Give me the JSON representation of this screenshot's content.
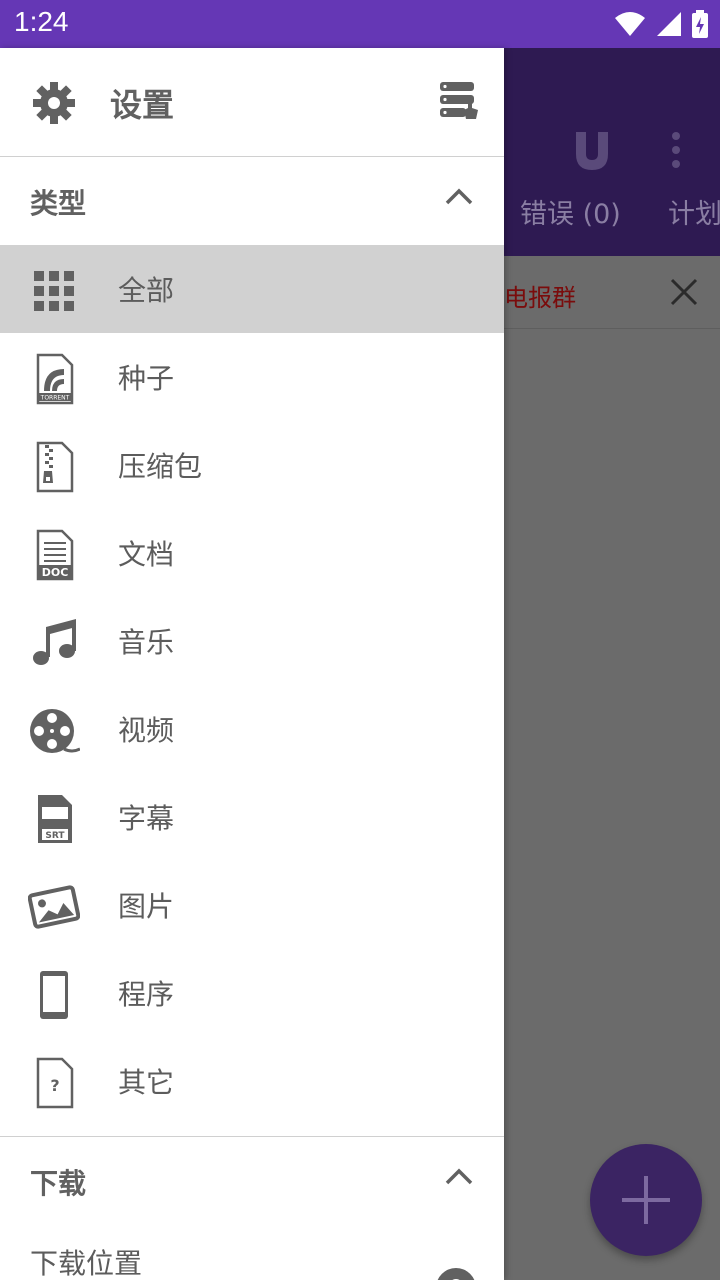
{
  "status_bar": {
    "time": "1:24"
  },
  "background_app": {
    "tabs": [
      "错误 (0)",
      "计划"
    ],
    "banner_text": "电报群"
  },
  "drawer": {
    "header": {
      "title": "设置"
    },
    "type_section": {
      "label": "类型",
      "items": [
        {
          "label": "全部",
          "icon": "grid-icon",
          "selected": true
        },
        {
          "label": "种子",
          "icon": "torrent-file-icon"
        },
        {
          "label": "压缩包",
          "icon": "zip-file-icon"
        },
        {
          "label": "文档",
          "icon": "doc-file-icon"
        },
        {
          "label": "音乐",
          "icon": "music-note-icon"
        },
        {
          "label": "视频",
          "icon": "film-reel-icon"
        },
        {
          "label": "字幕",
          "icon": "srt-file-icon"
        },
        {
          "label": "图片",
          "icon": "image-icon"
        },
        {
          "label": "程序",
          "icon": "phone-icon"
        },
        {
          "label": "其它",
          "icon": "unknown-file-icon"
        }
      ]
    },
    "download_section": {
      "label": "下载",
      "items": [
        {
          "label": "下载位置"
        }
      ]
    }
  },
  "colors": {
    "status_bar": "#6537b5",
    "toolbar_dimmed": "#2e1a52",
    "scrim": "#6b6b6b",
    "selected_item": "#d1d1d1",
    "icon_gray": "#616161",
    "banner_text": "#7a0c0c"
  }
}
